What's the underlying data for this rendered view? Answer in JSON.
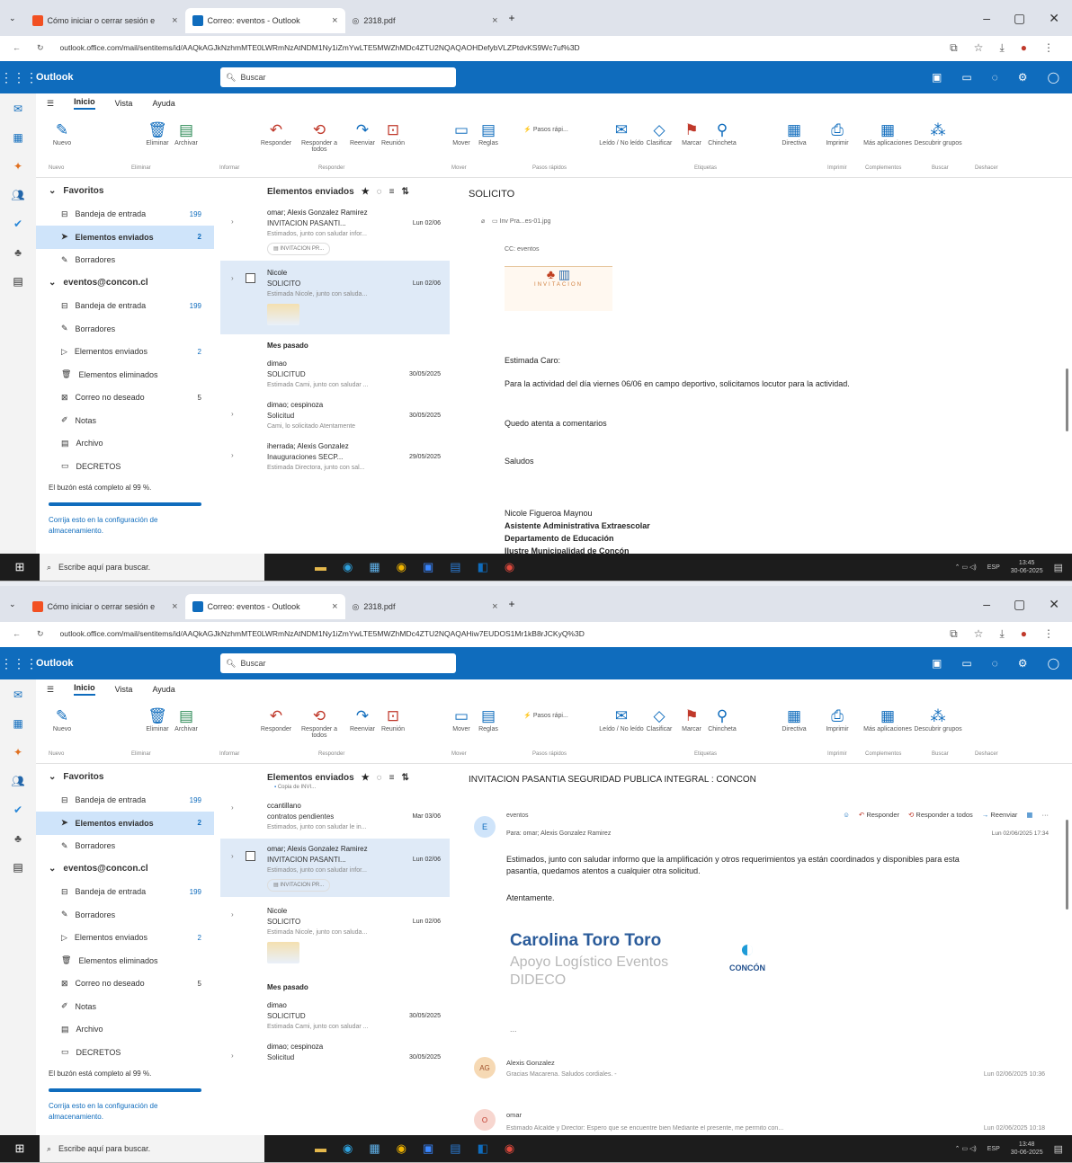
{
  "browser": {
    "tab1": "Cómo iniciar o cerrar sesión e",
    "tab2": "Correo: eventos - Outlook",
    "tab3": "2318.pdf",
    "url_top": "outlook.office.com/mail/sentitems/id/AAQkAGJkNzhmMTE0LWRmNzAtNDM1Ny1iZmYwLTE5MWZhMDc4ZTU2NQAQAOHDefybVLZPtdvKS9Wc7uf%3D",
    "url_bottom": "outlook.office.com/mail/sentitems/id/AAQkAGJkNzhmMTE0LWRmNzAtNDM1Ny1iZmYwLTE5MWZhMDc4ZTU2NQAQAHiw7EUDOS1Mr1kB8rJCKyQ%3D"
  },
  "app": {
    "name": "Outlook",
    "search": "Buscar"
  },
  "ribbon_tabs": [
    "Inicio",
    "Vista",
    "Ayuda"
  ],
  "ribbon": {
    "nuevo": "Nuevo",
    "eliminar": "Eliminar",
    "archivar": "Archivar",
    "responder": "Responder",
    "responder_todos": "Responder a todos",
    "reenviar": "Reenviar",
    "reunion": "Reunión",
    "mover": "Mover",
    "reglas": "Reglas",
    "pasos": "Pasos rápi...",
    "leido": "Leído / No leído",
    "clasificar": "Clasificar",
    "marcar": "Marcar",
    "chincheta": "Chincheta",
    "directiva": "Directiva",
    "imprimir": "Imprimir",
    "mas_apps": "Más aplicaciones",
    "descubrir": "Descubrir grupos",
    "g_nuevo": "Nuevo",
    "g_eliminar": "Eliminar",
    "g_informar": "Informar",
    "g_responder": "Responder",
    "g_mover": "Mover",
    "g_pasos": "Pasos rápidos",
    "g_etiquetas": "Etiquetas",
    "g_imprimir": "Imprimir",
    "g_complementos": "Complementos",
    "g_buscar": "Buscar",
    "g_deshacer": "Deshacer"
  },
  "folders": {
    "favoritos": "Favoritos",
    "bandeja": "Bandeja de entrada",
    "bandeja_count": "199",
    "enviados": "Elementos enviados",
    "enviados_count": "2",
    "borradores": "Borradores",
    "account": "eventos@concon.cl",
    "eliminados": "Elementos eliminados",
    "no_deseado": "Correo no deseado",
    "no_deseado_count": "5",
    "notas": "Notas",
    "archivo": "Archivo",
    "decretos": "DECRETOS",
    "quota": "El buzón está completo al 99 %.",
    "quota_link": "Corrija esto en la configuración de almacenamiento."
  },
  "list": {
    "title": "Elementos enviados",
    "mes_pasado": "Mes pasado",
    "m_omar_from": "omar; Alexis Gonzalez Ramirez",
    "m_omar_subj": "INVITACION PASANTI...",
    "m_omar_date": "Lun 02/06",
    "m_omar_prev": "Estimados, junto con saludar infor...",
    "m_omar_att": "INVITACION PR...",
    "m_nicole_from": "Nicole",
    "m_nicole_subj": "SOLICITO",
    "m_nicole_date": "Lun 02/06",
    "m_nicole_prev": "Estimada Nicole, junto con saluda...",
    "m_dimao_from": "dimao",
    "m_dimao_subj": "SOLICITUD",
    "m_dimao_date": "30/05/2025",
    "m_dimao_prev": "Estimada Cami, junto con saludar ...",
    "m_dimao2_from": "dimao; cespinoza",
    "m_dimao2_subj": "Solicitud",
    "m_dimao2_date": "30/05/2025",
    "m_dimao2_prev": "Cami, lo solicitado Atentamente",
    "m_iherrada_from": "iherrada; Alexis Gonzalez",
    "m_iherrada_subj": "Inauguraciones SECP...",
    "m_iherrada_date": "29/05/2025",
    "m_iherrada_prev": "Estimada Directora, junto con sal...",
    "m_ccant_from": "ccantillano",
    "m_ccant_subj": "contratos pendientes",
    "m_ccant_date": "Mar 03/06",
    "m_ccant_prev": "Estimados, junto con saludar le in...",
    "copia": "Copia de INVI..."
  },
  "reading1": {
    "subject": "SOLICITO",
    "attachment": "Inv Pra...es-01.jpg",
    "cc": "CC: eventos",
    "inv_label": "INVITACION",
    "greeting": "Estimada Caro:",
    "body": "Para la actividad del día viernes 06/06 en campo deportivo, solicitamos locutor para la actividad.",
    "closing": "Quedo atenta a comentarios",
    "saludos": "Saludos",
    "sig_name": "Nicole Figueroa Maynou",
    "sig_role": "Asistente Administrativa Extraescolar",
    "sig_dept": "Departamento de Educación",
    "sig_org": "Ilustre Municipalidad de Concón"
  },
  "reading2": {
    "subject": "INVITACION PASANTIA SEGURIDAD PUBLICA INTEGRAL : CONCON",
    "avatar": "E",
    "sender": "eventos",
    "to": "Para: omar; Alexis Gonzalez Ramirez",
    "date": "Lun 02/06/2025 17:34",
    "reply": "Responder",
    "reply_all": "Responder a todos",
    "forward": "Reenviar",
    "body": "Estimados, junto con saludar informo que la amplificación y otros requerimientos ya están coordinados y disponibles para esta pasantía, quedamos atentos a cualquier otra solicitud.",
    "closing": "Atentamente.",
    "sig_name": "Carolina Toro Toro",
    "sig_role": "Apoyo Logístico Eventos",
    "sig_dept": "DIDECO",
    "logo": "CONCÓN",
    "ellipsis": "...",
    "t1_avatar": "AG",
    "t1_from": "Alexis Gonzalez",
    "t1_prev": "Gracias Macarena. Saludos cordiales. -",
    "t1_date": "Lun 02/06/2025 10:36",
    "t2_avatar": "O",
    "t2_from": "omar",
    "t2_prev": "Estimado Alcalde y Director: Espero que se encuentre bien Mediante el presente, me permito con...",
    "t2_date": "Lun 02/06/2025 10:18"
  },
  "taskbar": {
    "search": "Escribe aquí para buscar.",
    "lang": "ESP",
    "time": "13:45",
    "date": "30-06-2025",
    "time2": "13:48"
  },
  "colors": {
    "accent": "#0f6cbd",
    "selected": "#cfe4fa"
  }
}
